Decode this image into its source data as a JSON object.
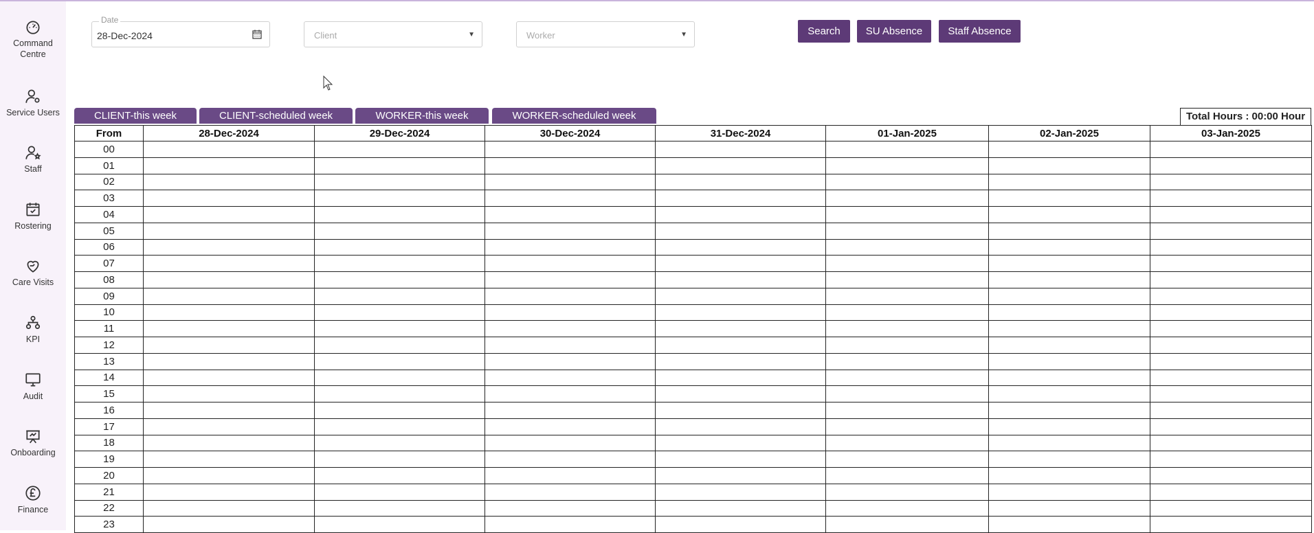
{
  "sidebar": {
    "items": [
      {
        "label_line1": "Command",
        "label_line2": "Centre",
        "icon": "gauge-icon"
      },
      {
        "label_line1": "Service Users",
        "label_line2": "",
        "icon": "user-settings-icon"
      },
      {
        "label_line1": "Staff",
        "label_line2": "",
        "icon": "user-star-icon"
      },
      {
        "label_line1": "Rostering",
        "label_line2": "",
        "icon": "calendar-check-icon"
      },
      {
        "label_line1": "Care Visits",
        "label_line2": "",
        "icon": "heart-hand-icon"
      },
      {
        "label_line1": "KPI",
        "label_line2": "",
        "icon": "org-chart-icon"
      },
      {
        "label_line1": "Audit",
        "label_line2": "",
        "icon": "monitor-icon"
      },
      {
        "label_line1": "Onboarding",
        "label_line2": "",
        "icon": "presentation-board-icon"
      },
      {
        "label_line1": "Finance",
        "label_line2": "",
        "icon": "pound-coin-icon"
      }
    ]
  },
  "filters": {
    "date_label": "Date",
    "date_value": "28-Dec-2024",
    "client_placeholder": "Client",
    "worker_placeholder": "Worker"
  },
  "buttons": {
    "search": "Search",
    "su_absence": "SU Absence",
    "staff_absence": "Staff Absence"
  },
  "tabs": [
    "CLIENT-this week",
    "CLIENT-scheduled week",
    "WORKER-this week",
    "WORKER-scheduled week"
  ],
  "total_hours": "Total Hours : 00:00 Hour",
  "grid": {
    "from_header": "From",
    "dates": [
      "28-Dec-2024",
      "29-Dec-2024",
      "30-Dec-2024",
      "31-Dec-2024",
      "01-Jan-2025",
      "02-Jan-2025",
      "03-Jan-2025"
    ],
    "hours": [
      "00",
      "01",
      "02",
      "03",
      "04",
      "05",
      "06",
      "07",
      "08",
      "09",
      "10",
      "11",
      "12",
      "13",
      "14",
      "15",
      "16",
      "17",
      "18",
      "19",
      "20",
      "21",
      "22",
      "23"
    ]
  },
  "colors": {
    "accent": "#5d3a77",
    "tab": "#6a4a86",
    "sidebar_bg": "#f8f2fa"
  }
}
